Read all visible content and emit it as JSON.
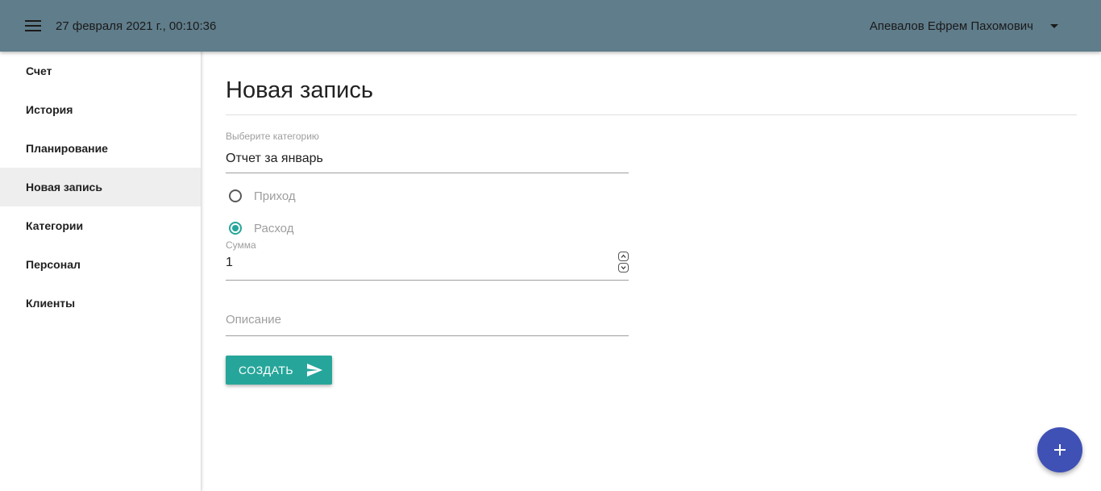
{
  "header": {
    "datetime": "27 февраля 2021 г., 00:10:36",
    "user_name": "Апевалов Ефрем Пахомович",
    "background_color": "#607d8b"
  },
  "sidebar": {
    "items": [
      {
        "label": "Счет",
        "active": false
      },
      {
        "label": "История",
        "active": false
      },
      {
        "label": "Планирование",
        "active": false
      },
      {
        "label": "Новая запись",
        "active": true
      },
      {
        "label": "Категории",
        "active": false
      },
      {
        "label": "Персонал",
        "active": false
      },
      {
        "label": "Клиенты",
        "active": false
      }
    ]
  },
  "main": {
    "title": "Новая запись",
    "category": {
      "label": "Выберите категорию",
      "value": "Отчет за январь"
    },
    "type_radios": [
      {
        "label": "Приход",
        "checked": false
      },
      {
        "label": "Расход",
        "checked": true
      }
    ],
    "amount": {
      "label": "Сумма",
      "value": "1"
    },
    "description": {
      "placeholder": "Описание",
      "value": ""
    },
    "submit_label": "СОЗДАТЬ",
    "accent_color": "#26a69a"
  },
  "fab": {
    "icon": "plus-icon",
    "color": "#3f51b5"
  }
}
